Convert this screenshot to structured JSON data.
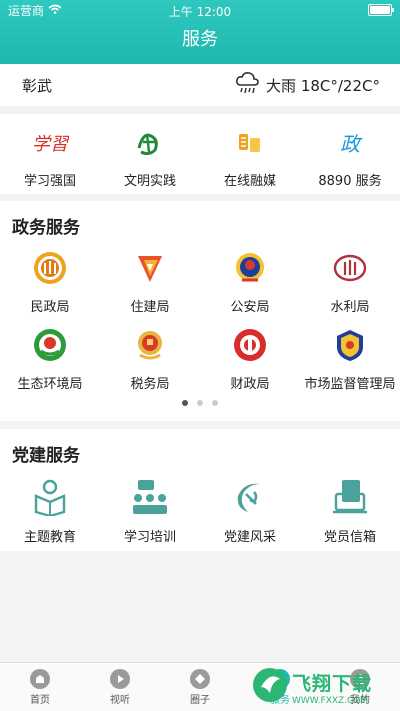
{
  "status": {
    "carrier": "运营商",
    "time": "上午 12:00"
  },
  "header": {
    "title": "服务"
  },
  "weather": {
    "location": "彰武",
    "desc": "大雨 18C°/22C°",
    "icon": "rain-cloud-icon"
  },
  "apps": [
    {
      "label": "学习强国",
      "icon": "xuexi-icon",
      "color": "#d6302a"
    },
    {
      "label": "文明实践",
      "icon": "wenming-icon",
      "color": "#1e8a3a"
    },
    {
      "label": "在线融媒",
      "icon": "rongmei-icon",
      "color": "#f0a21a"
    },
    {
      "label": "8890 服务",
      "icon": "zheng-icon",
      "color": "#1a9ad6"
    }
  ],
  "gov": {
    "title": "政务服务",
    "items": [
      {
        "label": "民政局",
        "icon": "minzheng-icon"
      },
      {
        "label": "住建局",
        "icon": "zhujian-icon"
      },
      {
        "label": "公安局",
        "icon": "police-badge-icon"
      },
      {
        "label": "水利局",
        "icon": "shuili-icon"
      },
      {
        "label": "生态环境局",
        "icon": "ecology-icon"
      },
      {
        "label": "税务局",
        "icon": "tax-emblem-icon"
      },
      {
        "label": "财政局",
        "icon": "finance-icon"
      },
      {
        "label": "市场监督管理局",
        "icon": "market-supervision-icon"
      }
    ]
  },
  "party": {
    "title": "党建服务",
    "items": [
      {
        "label": "主题教育",
        "icon": "reading-person-icon"
      },
      {
        "label": "学习培训",
        "icon": "training-icon"
      },
      {
        "label": "党建风采",
        "icon": "party-emblem-icon"
      },
      {
        "label": "党员信箱",
        "icon": "mailbox-icon"
      }
    ]
  },
  "tabs": [
    {
      "label": "首页",
      "icon": "home-icon"
    },
    {
      "label": "视听",
      "icon": "play-icon"
    },
    {
      "label": "圈子",
      "icon": "circle-icon"
    },
    {
      "label": "服务",
      "icon": "service-icon",
      "active": true
    },
    {
      "label": "我的",
      "icon": "user-icon"
    }
  ],
  "watermark": {
    "text": "飞翔下载",
    "url": "WWW.FXXZ.COM"
  }
}
